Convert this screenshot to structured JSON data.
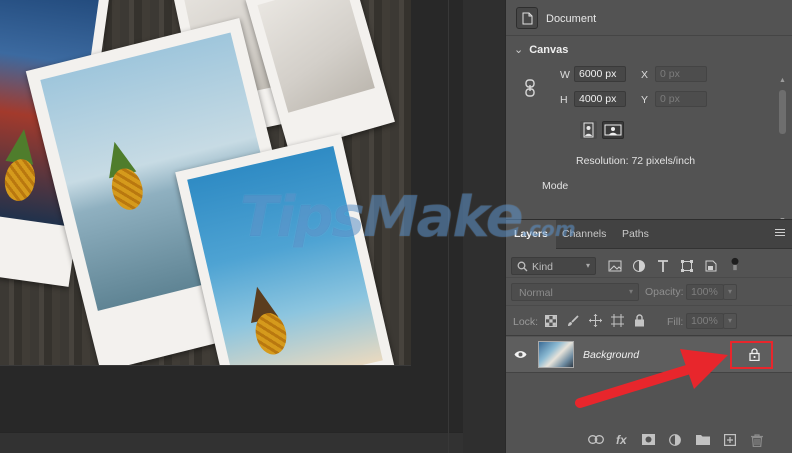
{
  "document_row": {
    "label": "Document"
  },
  "canvas": {
    "title": "Canvas",
    "width_label": "W",
    "width_value": "6000 px",
    "height_label": "H",
    "height_value": "4000 px",
    "x_label": "X",
    "x_placeholder": "0 px",
    "y_label": "Y",
    "y_placeholder": "0 px",
    "resolution": "Resolution: 72 pixels/inch",
    "mode_label": "Mode"
  },
  "layers": {
    "tabs": [
      "Layers",
      "Channels",
      "Paths"
    ],
    "active_tab": "Layers",
    "filter_placeholder": "Kind",
    "blend_mode": "Normal",
    "opacity_label": "Opacity:",
    "opacity_value": "100%",
    "lock_label": "Lock:",
    "fill_label": "Fill:",
    "fill_value": "100%",
    "layer": {
      "name": "Background",
      "visible": true,
      "locked": true
    },
    "bottom_icons": [
      "link-icon",
      "fx-icon",
      "mask-icon",
      "adjustment-icon",
      "folder-icon",
      "new-layer-icon",
      "trash-icon"
    ],
    "fx_label": "fx"
  },
  "watermark": {
    "text": "TipsMake",
    "suffix": ".com"
  },
  "colors": {
    "annotation_red": "#e8262c",
    "panel_bg": "#535353",
    "active_layer_bg": "#5e5e5e"
  }
}
